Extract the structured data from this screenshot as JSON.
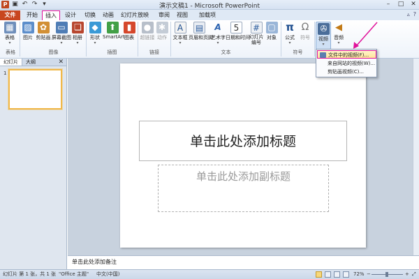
{
  "window": {
    "title": "演示文稿1 - Microsoft PowerPoint",
    "qat_icons": [
      "powerpoint-logo-icon",
      "save-icon",
      "undo-icon",
      "redo-icon",
      "customize-qat-icon"
    ],
    "controls": [
      "minimize-icon",
      "maximize-icon",
      "close-icon"
    ]
  },
  "tabs": [
    {
      "label": "文件"
    },
    {
      "label": "开始"
    },
    {
      "label": "插入",
      "active": true
    },
    {
      "label": "设计"
    },
    {
      "label": "切换"
    },
    {
      "label": "动画"
    },
    {
      "label": "幻灯片放映"
    },
    {
      "label": "审阅"
    },
    {
      "label": "视图"
    },
    {
      "label": "加载项"
    }
  ],
  "ribbon": {
    "table": {
      "label": "表格"
    },
    "picture": {
      "label": "图片"
    },
    "clipart": {
      "label": "剪贴画"
    },
    "screenshot": {
      "label": "屏幕截图"
    },
    "album": {
      "label": "相册"
    },
    "shapes": {
      "label": "形状"
    },
    "smartart": {
      "label": "SmartArt"
    },
    "chart": {
      "label": "图表"
    },
    "hyperlink": {
      "label": "超链接"
    },
    "action": {
      "label": "动作"
    },
    "textbox": {
      "label": "文本框"
    },
    "header_footer": {
      "label": "页眉和页脚"
    },
    "wordart": {
      "label": "艺术字"
    },
    "datetime": {
      "label": "日期和时间"
    },
    "slidenum": {
      "line1": "幻灯片",
      "line2": "编号"
    },
    "object": {
      "label": "对象"
    },
    "equation": {
      "label": "公式"
    },
    "symbol": {
      "label": "符号"
    },
    "video": {
      "label": "视频"
    },
    "audio": {
      "label": "音频"
    },
    "groups": {
      "tables": "表格",
      "images": "图像",
      "illustrations": "插图",
      "links": "链接",
      "text": "文本",
      "symbols": "符号"
    }
  },
  "video_menu": [
    {
      "label": "文件中的视频(F)...",
      "highlighted": true
    },
    {
      "label": "来自网站的视频(W)..."
    },
    {
      "label": "剪贴画视频(C)..."
    }
  ],
  "left_pane": {
    "tabs": [
      "幻灯片",
      "大纲"
    ],
    "slide_number": "1"
  },
  "slide": {
    "title_placeholder": "单击此处添加标题",
    "subtitle_placeholder": "单击此处添加副标题"
  },
  "notes": {
    "placeholder": "单击此处添加备注"
  },
  "status": {
    "slide_info": "幻灯片 第 1 张，共 1 张",
    "theme": "\"Office 主题\"",
    "language": "中文(中国)",
    "zoom": "72%"
  },
  "colors": {
    "accent_highlight": "#e0119a",
    "file_tab": "#c8461f"
  }
}
